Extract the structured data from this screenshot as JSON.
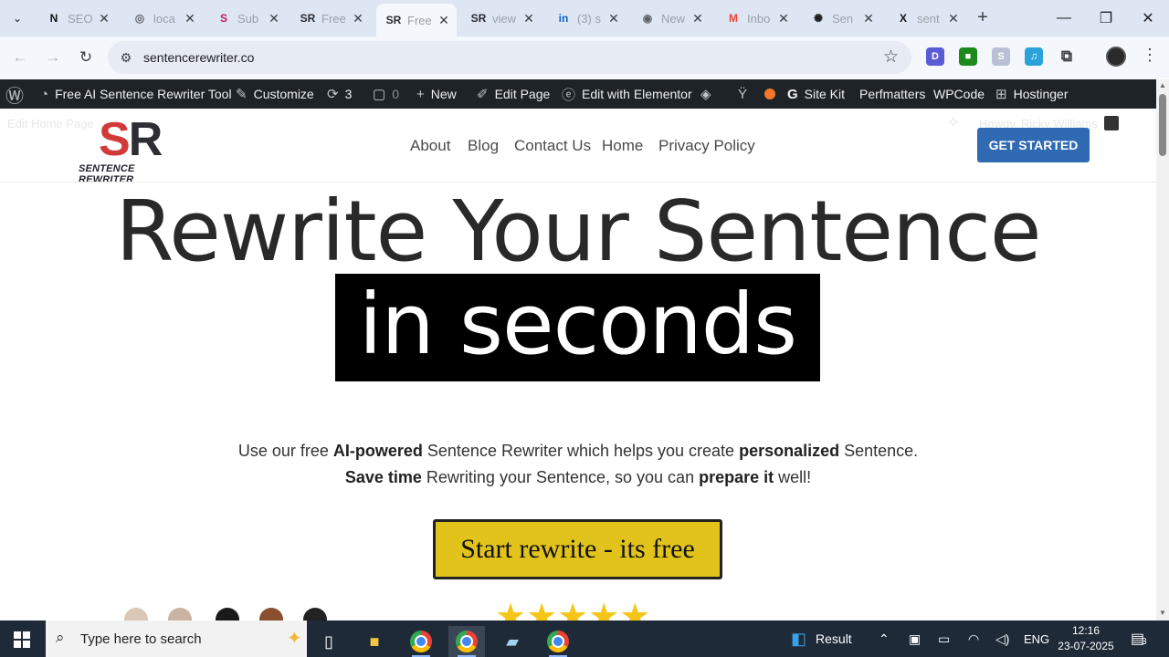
{
  "browser": {
    "tabs": [
      {
        "icon": "notion-icon",
        "glyph": "N",
        "title": "SEO",
        "fav_color": "#111111"
      },
      {
        "icon": "globe-icon",
        "glyph": "◎",
        "title": "loca",
        "fav_color": "#5f6368"
      },
      {
        "icon": "substack-icon",
        "glyph": "S",
        "title": "Sub",
        "fav_color": "#c2185b"
      },
      {
        "icon": "sr-icon",
        "glyph": "SR",
        "title": "Free",
        "fav_color": "#2b2b33"
      },
      {
        "icon": "sr-icon",
        "glyph": "SR",
        "title": "Free",
        "fav_color": "#2b2b33"
      },
      {
        "icon": "sr-icon",
        "glyph": "SR",
        "title": "view",
        "fav_color": "#2b2b33"
      },
      {
        "icon": "linkedin-icon",
        "glyph": "in",
        "title": "(3) s",
        "fav_color": "#0a66c2"
      },
      {
        "icon": "chrome-icon",
        "glyph": "◉",
        "title": "New",
        "fav_color": "#5f6368"
      },
      {
        "icon": "gmail-icon",
        "glyph": "M",
        "title": "Inbo",
        "fav_color": "#ea4335"
      },
      {
        "icon": "openai-icon",
        "glyph": "✺",
        "title": "Sen",
        "fav_color": "#202124"
      },
      {
        "icon": "x-icon",
        "glyph": "X",
        "title": "sent",
        "fav_color": "#111111"
      }
    ],
    "active_tab": 4,
    "url": "sentencerewriter.co",
    "extensions": [
      {
        "icon": "extension-d-icon",
        "glyph": "D",
        "color": "#5b5bd6"
      },
      {
        "icon": "extension-green-icon",
        "glyph": "■",
        "color": "#1b8a1b"
      },
      {
        "icon": "extension-s-icon",
        "glyph": "S",
        "color": "#b8c1d3"
      },
      {
        "icon": "extension-music-icon",
        "glyph": "♫",
        "color": "#29a3d9"
      },
      {
        "icon": "puzzle-icon",
        "glyph": "⧉",
        "color": "#3c4043"
      }
    ]
  },
  "wp_admin_bar": {
    "site_name": "Free AI Sentence Rewriter Tool",
    "customize": "Customize",
    "updates": "3",
    "comments": "0",
    "new": "New",
    "edit_page": "Edit Page",
    "elementor": "Edit with Elementor",
    "site_kit": "Site Kit",
    "perfmatters": "Perfmatters",
    "wpcode": "WPCode",
    "hostinger": "Hostinger",
    "faint_left": "Edit Home Page",
    "faint_right": "Howdy, Ricky Williams"
  },
  "site": {
    "logo_s": "S",
    "logo_r": "R",
    "logo_tagline": "SENTENCE REWRITER",
    "menu": [
      "About",
      "Blog",
      "Contact Us",
      "Home",
      "Privacy Policy"
    ],
    "cta": "GET STARTED",
    "hero_line1": "Rewrite Your Sentence",
    "hero_line2": "in seconds",
    "sub1": [
      {
        "t": "Use our free ",
        "b": false
      },
      {
        "t": "AI-powered",
        "b": true
      },
      {
        "t": " Sentence Rewriter which helps you create ",
        "b": false
      },
      {
        "t": "personalized",
        "b": true
      },
      {
        "t": " Sentence.",
        "b": false
      }
    ],
    "sub2": [
      {
        "t": "Save time",
        "b": true
      },
      {
        "t": " Rewriting your Sentence, so you can ",
        "b": false
      },
      {
        "t": "prepare it",
        "b": true
      },
      {
        "t": " well!",
        "b": false
      }
    ],
    "start_button": "Start rewrite - its free",
    "rating_stars": "★★★★★"
  },
  "taskbar": {
    "search_placeholder": "Type here to search",
    "weather_label": "Result",
    "language": "ENG",
    "time": "12:16",
    "date": "23-07-2025",
    "notifications": "3"
  }
}
